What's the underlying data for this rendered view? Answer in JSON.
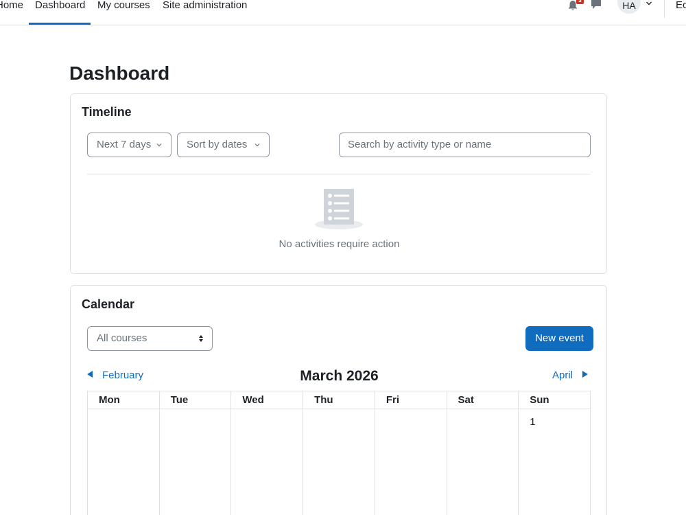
{
  "nav": {
    "items": [
      "Home",
      "Dashboard",
      "My courses",
      "Site administration"
    ],
    "active": "Dashboard",
    "notification_count": "3",
    "avatar_initials": "HA",
    "edit_mode_label": "Ec"
  },
  "page": {
    "title": "Dashboard"
  },
  "timeline": {
    "title": "Timeline",
    "filter_label": "Next 7 days",
    "sort_label": "Sort by dates",
    "search_placeholder": "Search by activity type or name",
    "empty_message": "No activities require action"
  },
  "calendar": {
    "title": "Calendar",
    "course_filter": "All courses",
    "new_event_label": "New event",
    "prev_month": "February",
    "next_month": "April",
    "current_month": "March 2026",
    "weekdays": [
      "Mon",
      "Tue",
      "Wed",
      "Thu",
      "Fri",
      "Sat",
      "Sun"
    ],
    "first_week": [
      "",
      "",
      "",
      "",
      "",
      "",
      "1"
    ]
  },
  "colors": {
    "accent": "#0f6cbf",
    "badge": "#ca3120",
    "muted_text": "#6a737b",
    "border": "#dee2e6"
  },
  "icons": [
    "bell-icon",
    "chat-icon",
    "chevron-down-icon",
    "list-document-icon",
    "triangle-left-icon",
    "triangle-right-icon",
    "sort-updown-icon"
  ]
}
